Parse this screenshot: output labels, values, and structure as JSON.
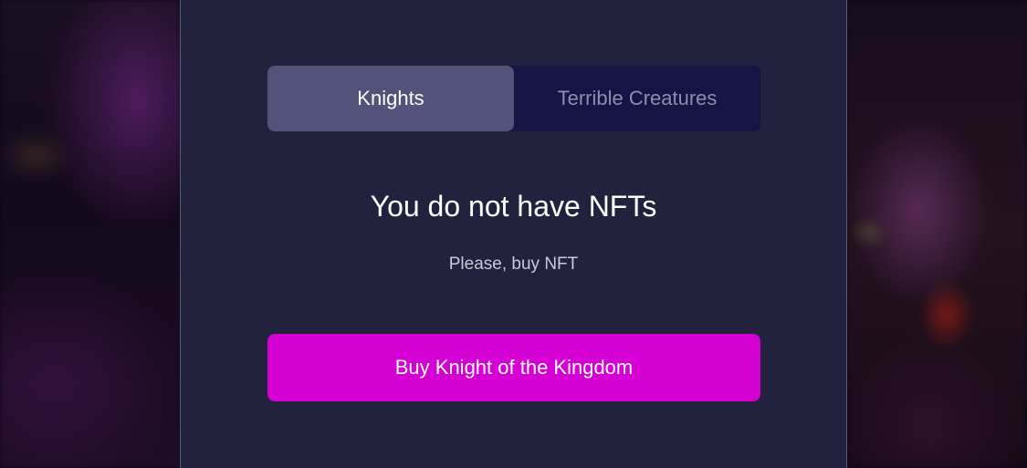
{
  "tabs": [
    {
      "label": "Knights",
      "active": true
    },
    {
      "label": "Terrible Creatures",
      "active": false
    }
  ],
  "empty_state": {
    "title": "You do not have NFTs",
    "subtitle": "Please, buy NFT"
  },
  "actions": {
    "buy_label": "Buy Knight of the Kingdom"
  },
  "colors": {
    "panel_background": "#22223f",
    "tab_container": "#151545",
    "tab_active": "#52527a",
    "tab_inactive_text": "#8d8dac",
    "primary_button": "#d400d4"
  }
}
